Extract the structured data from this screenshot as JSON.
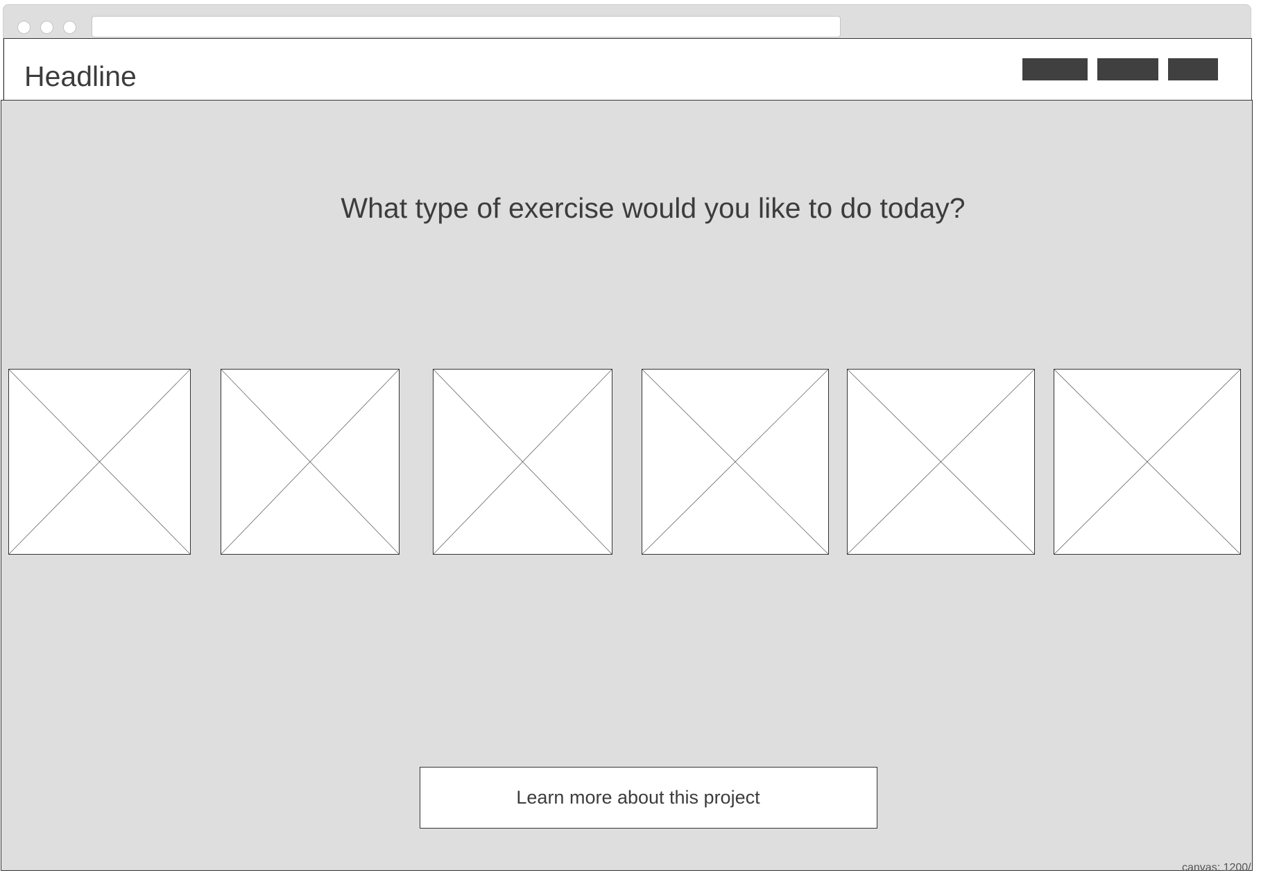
{
  "header": {
    "headline": "Headline",
    "nav_items": [
      {
        "name": "nav-item-1",
        "label": ""
      },
      {
        "name": "nav-item-2",
        "label": ""
      },
      {
        "name": "nav-item-3",
        "label": ""
      }
    ]
  },
  "main": {
    "question": "What type of exercise would you like to do today?",
    "exercise_options_count": 6,
    "cta_label": "Learn more about this project"
  },
  "footer_note": "canvas: 1200/",
  "colors": {
    "background": "#dedede",
    "surface": "#ffffff",
    "border": "#333333",
    "nav_block": "#404040",
    "text": "#3c3c3c"
  }
}
